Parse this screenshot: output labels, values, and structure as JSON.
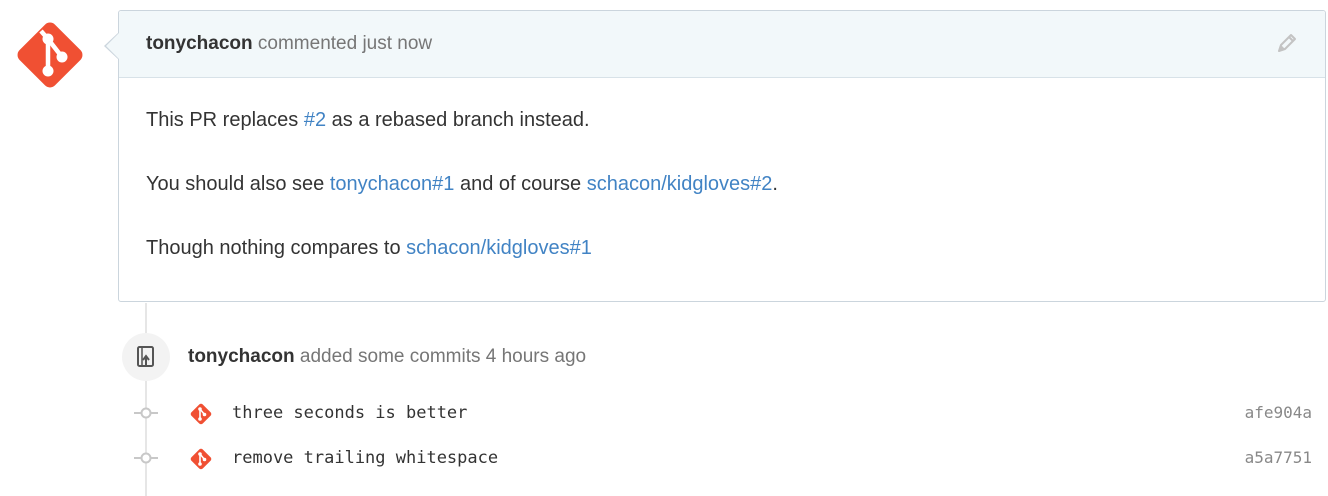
{
  "colors": {
    "git_logo": "#f05033",
    "link": "#4183c4",
    "header_bg": "#f2f8fa",
    "border": "#cbd5dd",
    "muted_text": "#767676"
  },
  "comment": {
    "author": "tonychacon",
    "action": "commented just now",
    "edit_icon": "pencil-icon",
    "body": {
      "line1": {
        "prefix": "This PR replaces ",
        "link": "#2",
        "suffix": " as a rebased branch instead."
      },
      "line2": {
        "prefix": "You should also see ",
        "link1": "tonychacon#1",
        "middle": " and of course ",
        "link2": "schacon/kidgloves#2",
        "suffix": "."
      },
      "line3": {
        "prefix": "Though nothing compares to ",
        "link": "schacon/kidgloves#1"
      }
    }
  },
  "commit_event": {
    "icon": "repo-push-icon",
    "author": "tonychacon",
    "action": "added some commits 4 hours ago",
    "commits": [
      {
        "message": "three seconds is better",
        "sha": "afe904a"
      },
      {
        "message": "remove trailing whitespace",
        "sha": "a5a7751"
      }
    ]
  }
}
